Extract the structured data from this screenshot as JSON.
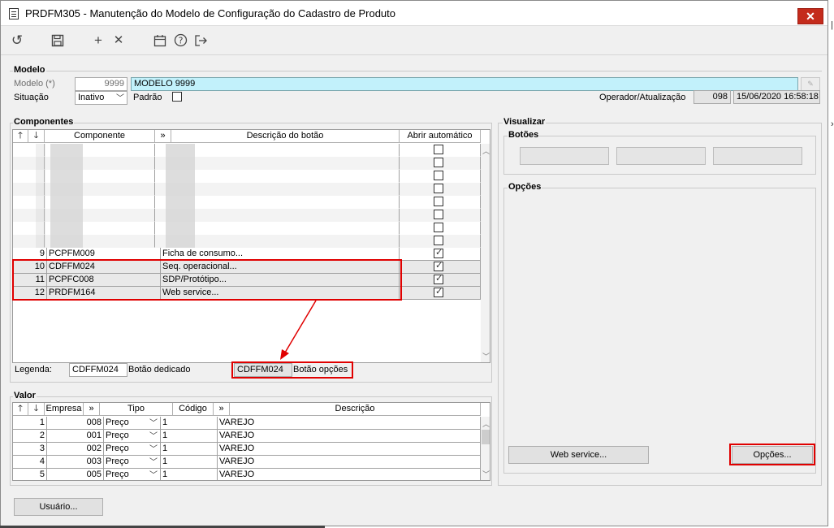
{
  "window": {
    "title": "PRDFM305 - Manutenção do Modelo de Configuração do Cadastro de Produto",
    "close_glyph": "✕"
  },
  "toolbar": {
    "icons": [
      "undo-icon",
      "save-icon",
      "add-icon",
      "delete-icon",
      "calendar-icon",
      "help-icon",
      "exit-icon"
    ],
    "glyphs": {
      "undo": "↺",
      "save": "🖫",
      "add": "+",
      "delete": "✕",
      "calendar": "📅",
      "help": "?",
      "exit": "⇥"
    }
  },
  "modelo": {
    "section_label": "Modelo",
    "modelo_label": "Modelo (*)",
    "modelo_code": "9999",
    "modelo_name": "MODELO 9999",
    "situacao_label": "Situação",
    "situacao_value": "Inativo",
    "padrao_label": "Padrão",
    "padrao_checked": false,
    "operador_label": "Operador/Atualização",
    "operador_value": "098",
    "atualizacao_value": "15/06/2020 16:58:18"
  },
  "componentes": {
    "section_label": "Componentes",
    "headers": {
      "componente": "Componente",
      "more": "»",
      "descricao": "Descrição do botão",
      "abrir": "Abrir automático"
    },
    "blurred_row_count": 8,
    "rows": [
      {
        "num": "9",
        "componente": "PCPFM009",
        "descricao": "Ficha de consumo...",
        "abrir": true
      },
      {
        "num": "10",
        "componente": "CDFFM024",
        "descricao": "Seq. operacional...",
        "abrir": true
      },
      {
        "num": "11",
        "componente": "PCPFC008",
        "descricao": "SDP/Protótipo...",
        "abrir": true
      },
      {
        "num": "12",
        "componente": "PRDFM164",
        "descricao": "Web service...",
        "abrir": true
      }
    ],
    "legenda_label": "Legenda:",
    "legenda_dedicado_code": "CDFFM024",
    "legenda_dedicado_label": "Botão dedicado",
    "legenda_opcoes_code": "CDFFM024",
    "legenda_opcoes_label": "Botão opções"
  },
  "valor": {
    "section_label": "Valor",
    "headers": {
      "empresa": "Empresa",
      "more": "»",
      "tipo": "Tipo",
      "codigo": "Código",
      "more2": "»",
      "descricao": "Descrição"
    },
    "rows": [
      {
        "num": "1",
        "empresa": "008",
        "tipo": "Preço",
        "codigo": "1",
        "descricao": "VAREJO"
      },
      {
        "num": "2",
        "empresa": "001",
        "tipo": "Preço",
        "codigo": "1",
        "descricao": "VAREJO"
      },
      {
        "num": "3",
        "empresa": "002",
        "tipo": "Preço",
        "codigo": "1",
        "descricao": "VAREJO"
      },
      {
        "num": "4",
        "empresa": "003",
        "tipo": "Preço",
        "codigo": "1",
        "descricao": "VAREJO"
      },
      {
        "num": "5",
        "empresa": "005",
        "tipo": "Preço",
        "codigo": "1",
        "descricao": "VAREJO"
      }
    ]
  },
  "visualizar": {
    "section_label": "Visualizar",
    "botoes_label": "Botões",
    "opcoes_label": "Opções",
    "web_service_button": "Web service...",
    "opcoes_button": "Opções..."
  },
  "footer": {
    "usuario_button": "Usuário..."
  },
  "colors": {
    "highlight_red": "#e00000",
    "cyan_field": "#c2f1fb",
    "close_red": "#c42b1c"
  }
}
